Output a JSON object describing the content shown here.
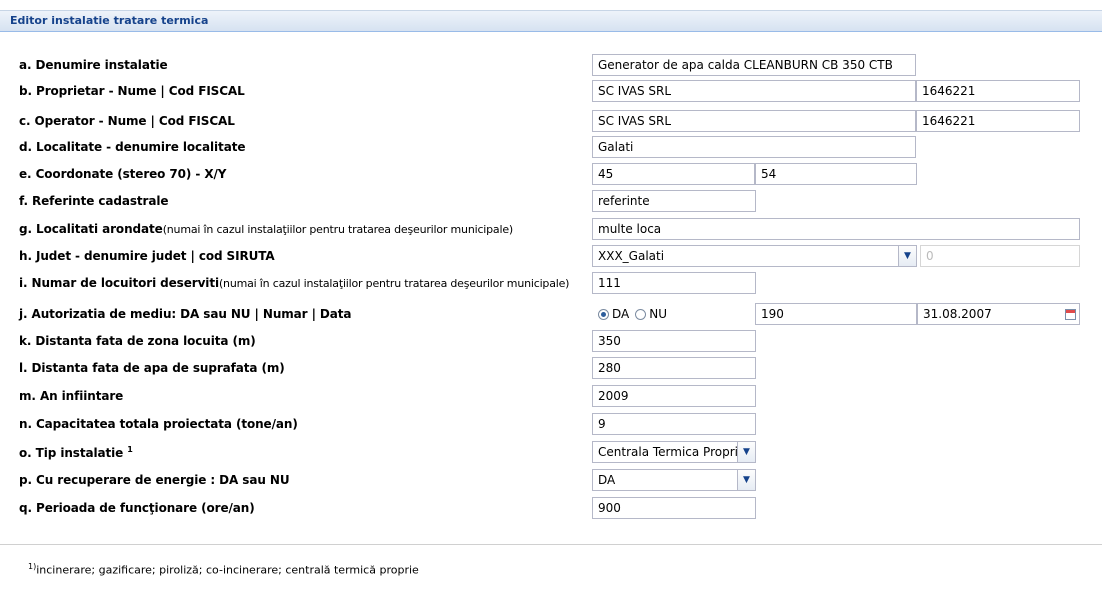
{
  "panel": {
    "title": "Editor instalatie tratare termica"
  },
  "rows": {
    "a": {
      "label": "a. Denumire instalatie",
      "value": "Generator de apa calda CLEANBURN CB 350 CTB"
    },
    "b": {
      "label": "b. Proprietar - Nume | Cod FISCAL",
      "name": "SC IVAS SRL",
      "code": "1646221"
    },
    "c": {
      "label": "c. Operator - Nume | Cod FISCAL",
      "name": "SC IVAS SRL",
      "code": "1646221"
    },
    "d": {
      "label": "d. Localitate - denumire localitate",
      "value": "Galati"
    },
    "e": {
      "label": "e. Coordonate (stereo 70) - X/Y",
      "x": "45",
      "y": "54"
    },
    "f": {
      "label": "f. Referinte cadastrale",
      "value": "referinte"
    },
    "g": {
      "label": "g. Localitati arondate",
      "note": "(numai în cazul instalaţiilor pentru tratarea deşeurilor municipale)",
      "value": "multe loca"
    },
    "h": {
      "label": "h. Judet - denumire judet | cod SIRUTA",
      "judet": "XXX_Galati",
      "siruta": "0"
    },
    "i": {
      "label": "i. Numar de locuitori deserviti",
      "note": "(numai în cazul instalaţiilor pentru tratarea deşeurilor municipale)",
      "value": "111"
    },
    "j": {
      "label": "j. Autorizatia de mediu: DA sau NU | Numar | Data",
      "option_da": "DA",
      "option_nu": "NU",
      "selected": "DA",
      "numar": "190",
      "data": "31.08.2007"
    },
    "k": {
      "label": "k. Distanta fata de zona locuita (m)",
      "value": "350"
    },
    "l": {
      "label": "l. Distanta fata de apa de suprafata (m)",
      "value": "280"
    },
    "m": {
      "label": "m. An infiintare",
      "value": "2009"
    },
    "n": {
      "label": "n. Capacitatea totala proiectata (tone/an)",
      "value": "9"
    },
    "o": {
      "label": "o. Tip instalatie",
      "sup": "1",
      "value": "Centrala Termica Proprie"
    },
    "p": {
      "label": "p. Cu recuperare de energie : DA sau NU",
      "value": "DA"
    },
    "q": {
      "label": "q. Perioada de funcţionare (ore/an)",
      "value": "900"
    }
  },
  "footnote": {
    "sup": "1)",
    "text": "incinerare; gazificare; piroliză; co-incinerare; centrală termică proprie"
  },
  "icons": {
    "combo": "chevron-down-icon",
    "date": "calendar-icon"
  },
  "colors": {
    "header_text": "#15428b",
    "field_border": "#b5b8c8"
  }
}
